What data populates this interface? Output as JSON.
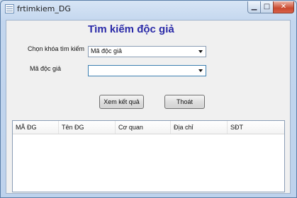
{
  "window": {
    "title": "frtimkiem_DG",
    "controls": {
      "minimize": "▁",
      "maximize": "□",
      "close": "✕"
    }
  },
  "form": {
    "heading": "Tìm kiếm độc giả",
    "search_key_label": "Chọn khóa tìm kiếm",
    "search_key_value": "Mã độc giả",
    "reader_id_label": "Mã độc giả",
    "reader_id_value": "",
    "view_button": "Xem kết quả",
    "exit_button": "Thoát"
  },
  "grid": {
    "columns": [
      "MÃ ĐG",
      "Tên ĐG",
      "Cơ quan",
      "Địa chỉ",
      "SĐT"
    ]
  },
  "colors": {
    "heading": "#2a2aa8",
    "close_button": "#c9492e"
  }
}
